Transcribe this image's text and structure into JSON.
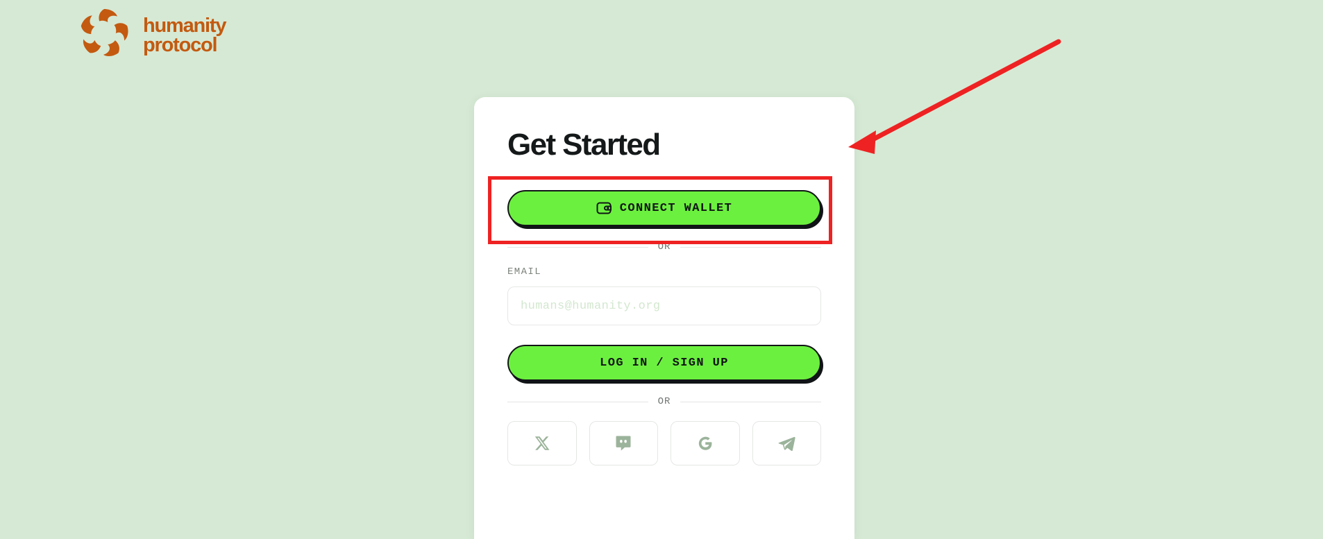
{
  "colors": {
    "page_background": "#d6e9d5",
    "card_background": "#ffffff",
    "brand_orange": "#c35a10",
    "accent_green": "#6cf03f",
    "text_dark": "#15191a",
    "muted_text": "#7c837c",
    "placeholder_green": "#d3e7cf",
    "social_icon": "#9bb39a",
    "annotation_red": "#ee2222"
  },
  "brand": {
    "mark_icon": "humanity-protocol-petal-mark-icon",
    "name_line1": "humanity",
    "name_line2": "protocol"
  },
  "card": {
    "title": "Get Started",
    "connect_wallet": {
      "label": "CONNECT WALLET",
      "icon": "wallet-icon"
    },
    "divider_top": {
      "label": "OR"
    },
    "email": {
      "label": "EMAIL",
      "placeholder": "humans@humanity.org",
      "value": ""
    },
    "login_signup": {
      "label": "LOG IN / SIGN UP"
    },
    "divider_bottom": {
      "label": "OR"
    },
    "social_buttons": [
      {
        "name": "x-twitter",
        "icon": "x-twitter-icon",
        "label": "X"
      },
      {
        "name": "discord",
        "icon": "discord-icon",
        "label": "Discord"
      },
      {
        "name": "google",
        "icon": "google-icon",
        "label": "Google"
      },
      {
        "name": "telegram",
        "icon": "telegram-icon",
        "label": "Telegram"
      }
    ]
  },
  "annotations": {
    "highlight_box_target": "CONNECT WALLET",
    "arrow": {
      "from": "top-right",
      "to": "card-top-right-corner"
    }
  }
}
